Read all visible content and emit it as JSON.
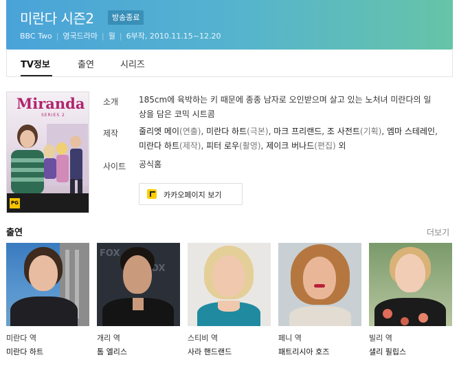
{
  "header": {
    "title": "미란다 시즌2",
    "badge": "방송종료",
    "meta": [
      "BBC Two",
      "영국드라마",
      "월",
      "6부작, 2010.11.15~12.20"
    ]
  },
  "tabs": [
    {
      "label": "TV정보",
      "active": true
    },
    {
      "label": "출연",
      "active": false
    },
    {
      "label": "시리즈",
      "active": false
    }
  ],
  "poster": {
    "title": "Miranda",
    "subtitle": "SERIES 2",
    "rating": "PG"
  },
  "info": {
    "synopsis_label": "소개",
    "synopsis": "185cm에 육박하는 키 때문에 종종 남자로 오인받으며 살고 있는 노처녀 미란다의 일상을 담은 코믹 시트콤",
    "production_label": "제작",
    "production": [
      {
        "name": "줄리엣 메이",
        "role": "(연출)"
      },
      {
        "name": "미란다 하트",
        "role": "(극본)"
      },
      {
        "name": "마크 프리랜드",
        "role": ""
      },
      {
        "name": "조 사전트",
        "role": "(기획)"
      },
      {
        "name": "엠마 스테레인",
        "role": ""
      },
      {
        "name": "미란다 하트",
        "role": "(제작)"
      },
      {
        "name": "피터 로우",
        "role": "(촬영)"
      },
      {
        "name": "제이크 버나드",
        "role": "(편집)"
      },
      {
        "name": "외",
        "role": ""
      }
    ],
    "site_label": "사이트",
    "site": "공식홈"
  },
  "kakao_button": "카카오페이지 보기",
  "cast_section": {
    "title": "출연",
    "more": "더보기",
    "cast": [
      {
        "role": "미란다 역",
        "name": "미란다 하트"
      },
      {
        "role": "개리 역",
        "name": "톰 엘리스"
      },
      {
        "role": "스티비 역",
        "name": "사라 핸드랜드"
      },
      {
        "role": "페니 역",
        "name": "패트리시아 호즈"
      },
      {
        "role": "빌리 역",
        "name": "샐리 필립스"
      }
    ]
  },
  "colors": {
    "header_gradient_start": "#4aa3d8",
    "header_gradient_end": "#66c4a8",
    "poster_title": "#b0246d",
    "kakao_yellow": "#ffcd00"
  }
}
